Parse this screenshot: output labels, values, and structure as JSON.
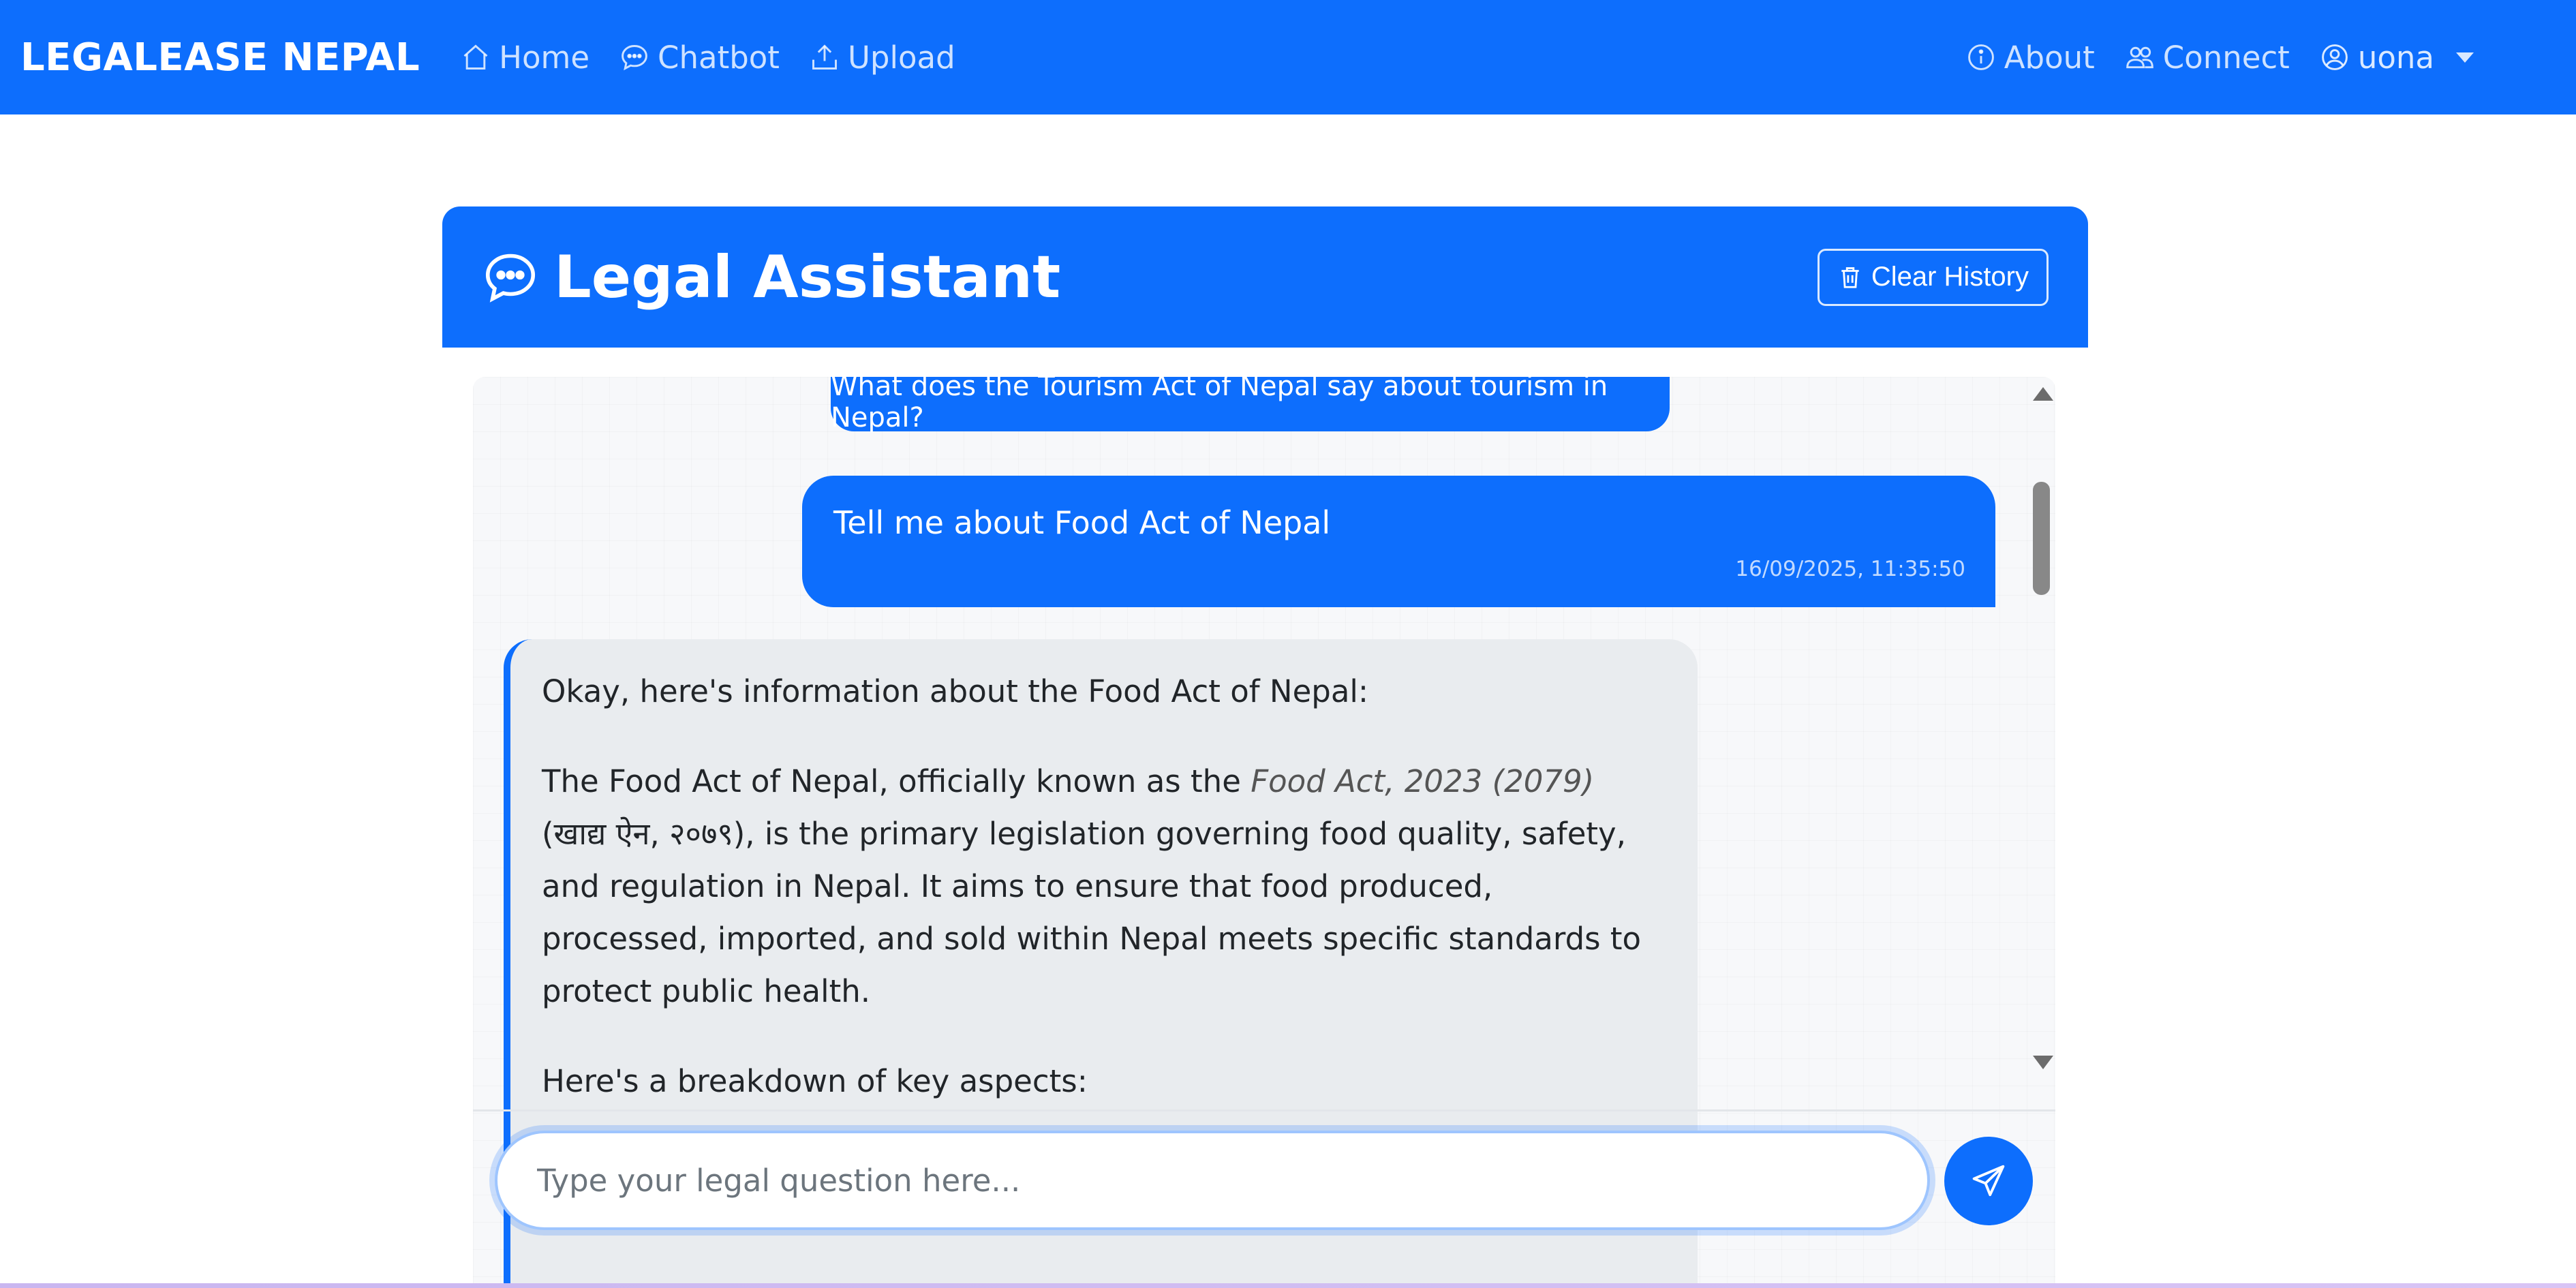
{
  "navbar": {
    "brand": "LEGALEASE NEPAL",
    "links": [
      {
        "label": "Home",
        "icon": "house-icon"
      },
      {
        "label": "Chatbot",
        "icon": "chat-dots-icon"
      },
      {
        "label": "Upload",
        "icon": "upload-icon"
      }
    ],
    "right": {
      "about": "About",
      "connect": "Connect",
      "user": "uona"
    },
    "colors": {
      "primary": "#0d6efd"
    }
  },
  "chat": {
    "title": "Legal Assistant",
    "clear_label": "Clear History",
    "messages": {
      "prev_user": "What does the Tourism Act of Nepal say about tourism in Nepal?",
      "user": {
        "text": "Tell me about Food Act of Nepal",
        "time": "16/09/2025, 11:35:50"
      },
      "bot": {
        "intro": "Okay, here's information about the Food Act of Nepal:",
        "para_start": "The Food Act of Nepal, officially known as the ",
        "act_name": "Food Act, 2023 (2079)",
        "para_rest": " (खाद्य ऐन, २०७९), is the primary legislation governing food quality, safety, and regulation in Nepal. It aims to ensure that food produced, processed, imported, and sold within Nepal meets specific standards to protect public health.",
        "breakdown": "Here's a breakdown of key aspects:"
      }
    },
    "input_placeholder": "Type your legal question here..."
  }
}
